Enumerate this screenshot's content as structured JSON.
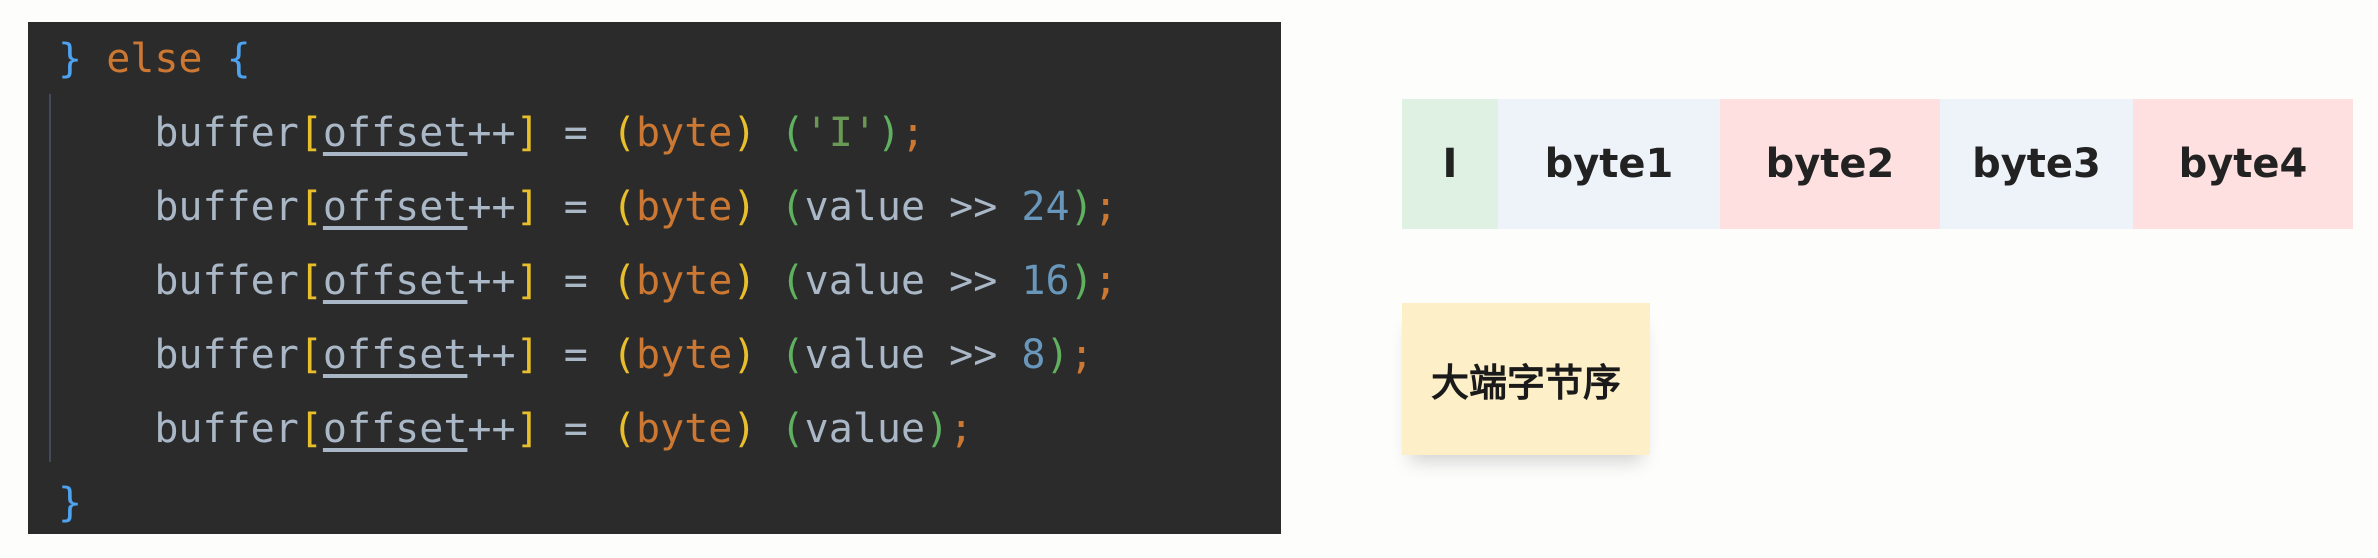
{
  "code": {
    "line0": {
      "brace": "}",
      "keyword": "else",
      "open": "{"
    },
    "statement": {
      "buffer": "buffer",
      "lbracket": "[",
      "field": "offset",
      "incr": "++",
      "rbracket": "]",
      "assign": " = ",
      "lparen": "(",
      "type": "byte",
      "rparen": ")"
    },
    "line1": {
      "open": "(",
      "literal": "'I'",
      "close": ")",
      "semi": ";"
    },
    "line2": {
      "open": "(",
      "expr": "value >> ",
      "num": "24",
      "close": ")",
      "semi": ";"
    },
    "line3": {
      "open": "(",
      "expr": "value >> ",
      "num": "16",
      "close": ")",
      "semi": ";"
    },
    "line4": {
      "open": "(",
      "expr": "value >> ",
      "num": "8",
      "close": ")",
      "semi": ";"
    },
    "line5": {
      "open": "(",
      "expr": "value",
      "close": ")",
      "semi": ";"
    },
    "line6": {
      "brace": "}"
    }
  },
  "diagram": {
    "cells": [
      {
        "label": "I",
        "color": "#def1e2"
      },
      {
        "label": "byte1",
        "color": "#eef3fa"
      },
      {
        "label": "byte2",
        "color": "#fde0df"
      },
      {
        "label": "byte3",
        "color": "#eef3fa"
      },
      {
        "label": "byte4",
        "color": "#fde0df"
      }
    ],
    "note": "大端字节序"
  }
}
